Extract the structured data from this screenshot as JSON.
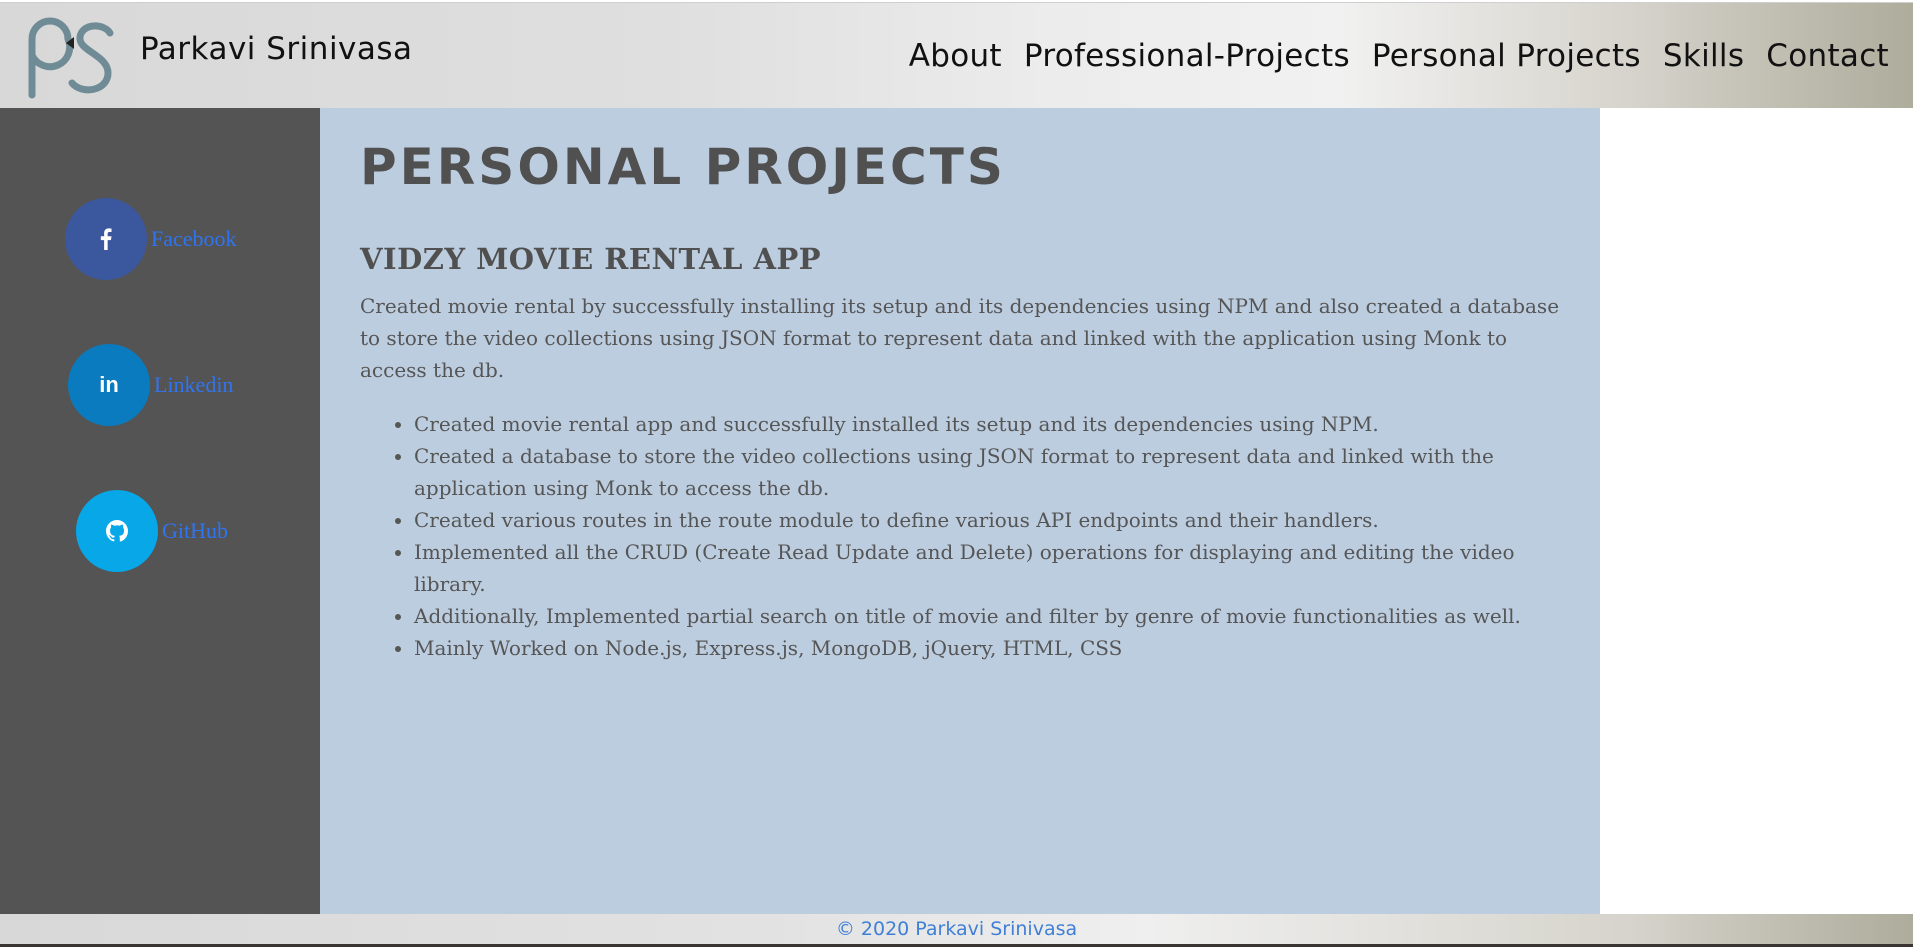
{
  "header": {
    "site_name": "Parkavi Srinivasa",
    "logo_text": "PS",
    "nav": [
      {
        "label": "About"
      },
      {
        "label": "Professional-Projects"
      },
      {
        "label": "Personal Projects"
      },
      {
        "label": "Skills"
      },
      {
        "label": "Contact"
      }
    ]
  },
  "sidebar": {
    "social": [
      {
        "label": "Facebook",
        "icon": "facebook-icon",
        "glyph": "f",
        "color": "#3b579d"
      },
      {
        "label": "Linkedin",
        "icon": "linkedin-icon",
        "glyph": "in",
        "color": "#0a7bbf"
      },
      {
        "label": "GitHub",
        "icon": "github-icon",
        "glyph": "",
        "color": "#07a7e8"
      }
    ]
  },
  "main": {
    "page_title": "PERSONAL PROJECTS",
    "project": {
      "title": "VIDZY MOVIE RENTAL APP",
      "description": "Created movie rental by successfully installing its setup and its dependencies using NPM and also created a database to store the video collections using JSON format to represent data and linked with the application using Monk to access the db.",
      "bullets": [
        "Created movie rental app and successfully installed its setup and its dependencies using NPM.",
        "Created a database to store the video collections using JSON format to represent data and linked with the application using Monk to access the db.",
        "Created various routes in the route module to define various API endpoints and their handlers.",
        "Implemented all the CRUD (Create Read Update and Delete) operations for displaying and editing the video library.",
        "Additionally, Implemented partial search on title of movie and filter by genre of movie functionalities as well.",
        "Mainly Worked on Node.js, Express.js, MongoDB, jQuery, HTML, CSS"
      ]
    }
  },
  "footer": {
    "copyright": "© 2020 Parkavi Srinivasa"
  },
  "colors": {
    "sidebar_bg": "#545454",
    "main_bg": "#bdcde0",
    "link": "#2f74f0",
    "heading": "#505050"
  }
}
